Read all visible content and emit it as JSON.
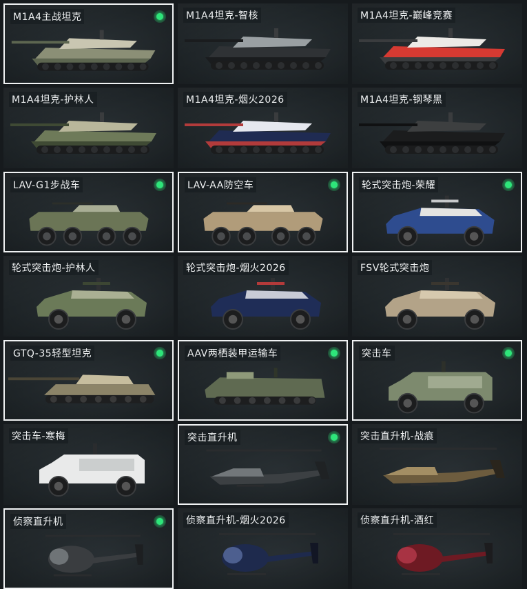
{
  "vehicles": [
    {
      "name": "M1A4主战坦克",
      "type": "tank",
      "selected": true,
      "equipped": true,
      "colors": [
        "#8b8f76",
        "#c9c6b1",
        "#5d6650"
      ]
    },
    {
      "name": "M1A4坦克-智核",
      "type": "tank",
      "selected": false,
      "equipped": false,
      "colors": [
        "#2f3235",
        "#9aa0a3",
        "#1a1c1e"
      ]
    },
    {
      "name": "M1A4坦克-巅峰竞赛",
      "type": "tank",
      "selected": false,
      "equipped": false,
      "colors": [
        "#d63a32",
        "#eceae6",
        "#3a3c3e"
      ]
    },
    {
      "name": "M1A4坦克-护林人",
      "type": "tank",
      "selected": false,
      "equipped": false,
      "colors": [
        "#6e7a59",
        "#b9b79b",
        "#3f4a34"
      ]
    },
    {
      "name": "M1A4坦克-烟火2026",
      "type": "tank",
      "selected": false,
      "equipped": false,
      "colors": [
        "#1f2b52",
        "#e6e8ef",
        "#b23b3b"
      ]
    },
    {
      "name": "M1A4坦克-钢琴黑",
      "type": "tank",
      "selected": false,
      "equipped": false,
      "colors": [
        "#1b1c1d",
        "#3d3f40",
        "#101112"
      ]
    },
    {
      "name": "LAV-G1步战车",
      "type": "apc8",
      "selected": true,
      "equipped": true,
      "colors": [
        "#6b7556",
        "#a9ae95",
        "#2c2f2a"
      ]
    },
    {
      "name": "LAV-AA防空车",
      "type": "apc8",
      "selected": true,
      "equipped": true,
      "colors": [
        "#b19c7a",
        "#d8c7a6",
        "#2c2a26"
      ]
    },
    {
      "name": "轮式突击炮-荣耀",
      "type": "car4",
      "selected": true,
      "equipped": true,
      "colors": [
        "#2e4c8f",
        "#e4e4e2",
        "#c7c9cb"
      ]
    },
    {
      "name": "轮式突击炮-护林人",
      "type": "car4",
      "selected": false,
      "equipped": false,
      "colors": [
        "#6b7a58",
        "#aab093",
        "#3c4633"
      ]
    },
    {
      "name": "轮式突击炮-烟火2026",
      "type": "car4",
      "selected": false,
      "equipped": false,
      "colors": [
        "#1f2d57",
        "#c8cbd6",
        "#b33a3a"
      ]
    },
    {
      "name": "FSV轮式突击炮",
      "type": "car4",
      "selected": false,
      "equipped": false,
      "colors": [
        "#b3a388",
        "#d6c9ae",
        "#3a362f"
      ]
    },
    {
      "name": "GTQ-35轻型坦克",
      "type": "lighttank",
      "selected": true,
      "equipped": true,
      "colors": [
        "#8c8468",
        "#c6bd9e",
        "#4a4536"
      ]
    },
    {
      "name": "AAV两栖装甲运输车",
      "type": "aav",
      "selected": true,
      "equipped": true,
      "colors": [
        "#5f6a51",
        "#8f9a7a",
        "#2f3529"
      ]
    },
    {
      "name": "突击车",
      "type": "truck",
      "selected": true,
      "equipped": true,
      "colors": [
        "#7d8a6e",
        "#b8c0a6",
        "#2d302a"
      ]
    },
    {
      "name": "突击车-寒梅",
      "type": "truck",
      "selected": false,
      "equipped": false,
      "colors": [
        "#e9eaea",
        "#b8babb",
        "#2a2c2e"
      ]
    },
    {
      "name": "突击直升机",
      "type": "heli",
      "selected": true,
      "equipped": true,
      "colors": [
        "#3c4043",
        "#72777a",
        "#1f2224"
      ]
    },
    {
      "name": "突击直升机-战痕",
      "type": "heli",
      "selected": false,
      "equipped": false,
      "colors": [
        "#6d5c3e",
        "#a38e64",
        "#2a251c"
      ]
    },
    {
      "name": "侦察直升机",
      "type": "smallheli",
      "selected": true,
      "equipped": true,
      "colors": [
        "#3a3d40",
        "#6f7477",
        "#1d1f21"
      ]
    },
    {
      "name": "侦察直升机-烟火2026",
      "type": "smallheli",
      "selected": false,
      "equipped": false,
      "colors": [
        "#1e2a4d",
        "#4d5f8f",
        "#121624"
      ]
    },
    {
      "name": "侦察直升机-酒红",
      "type": "smallheli",
      "selected": false,
      "equipped": false,
      "colors": [
        "#6e1a23",
        "#a83343",
        "#1c1c1e"
      ]
    }
  ]
}
